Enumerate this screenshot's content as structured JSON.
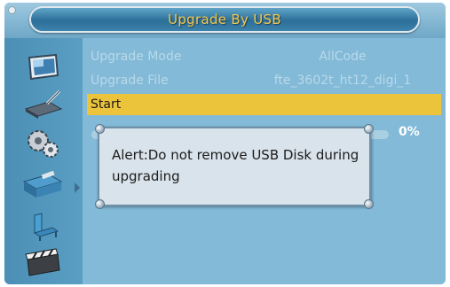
{
  "header": {
    "title": "Upgrade By USB"
  },
  "settings": [
    {
      "label": "Upgrade Mode",
      "value": "AllCode"
    },
    {
      "label": "Upgrade File",
      "value": "fte_3602t_ht12_digi_1"
    },
    {
      "label": "Start",
      "value": ""
    }
  ],
  "progress": {
    "percent_label": "0%",
    "value": 0
  },
  "alert": {
    "message": "Alert:Do not remove USB Disk during upgrading"
  },
  "sidebar": {
    "items": [
      {
        "icon": "tv-screen-icon"
      },
      {
        "icon": "satellite-dish-icon"
      },
      {
        "icon": "gears-icon"
      },
      {
        "icon": "tools-icon"
      },
      {
        "icon": "chair-icon"
      },
      {
        "icon": "clapperboard-icon"
      }
    ]
  },
  "colors": {
    "title_text": "#f7c74a",
    "selected_row": "#ecc43b",
    "background": "#82bad8"
  }
}
